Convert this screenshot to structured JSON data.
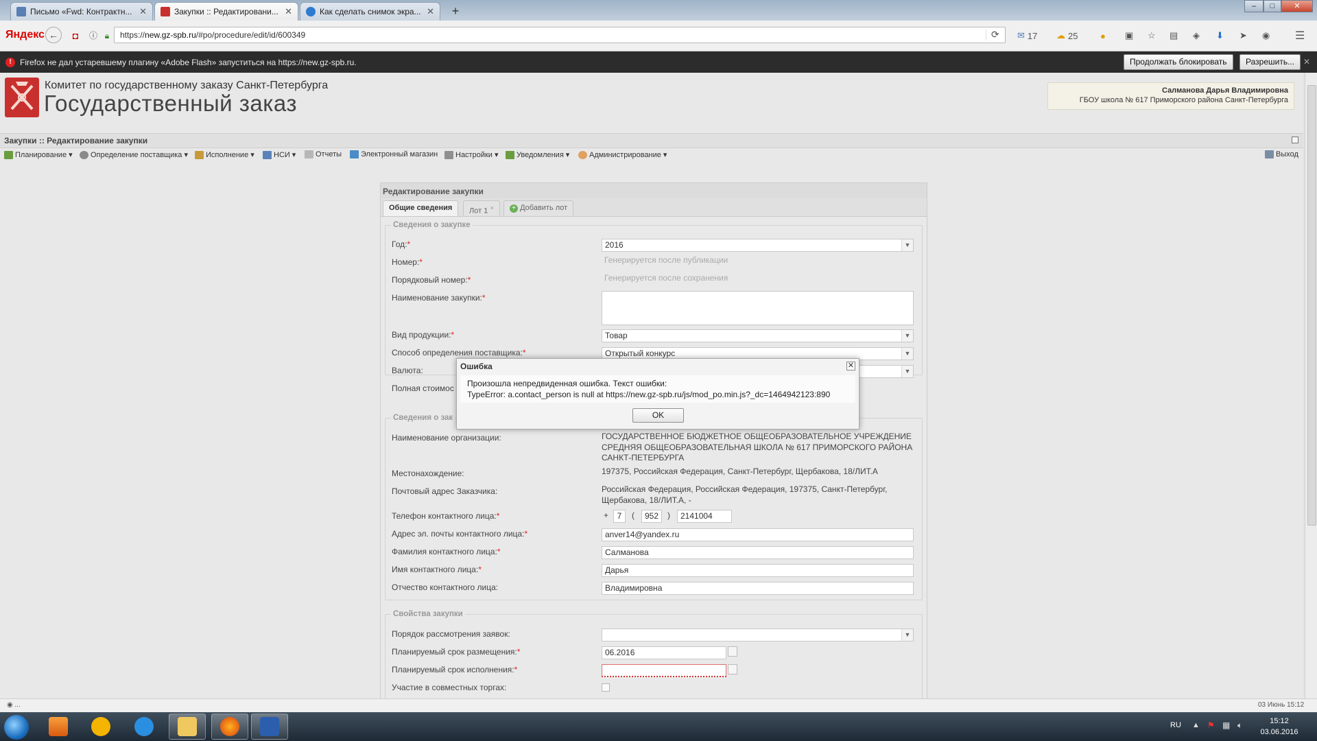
{
  "browser": {
    "tabs": [
      {
        "label": "Письмо «Fwd: Контрактн...",
        "active": false,
        "icon": "mail-icon"
      },
      {
        "label": "Закупки :: Редактировани...",
        "active": true,
        "icon": "gz-icon"
      },
      {
        "label": "Как сделать снимок экра...",
        "active": false,
        "icon": "globe-icon"
      }
    ],
    "new_tab": "+",
    "search_engine": "Яндекс",
    "url_prefix": "https://",
    "url_host": "new.gz-spb.ru",
    "url_path": "/#po/procedure/edit/id/600349",
    "toolbar": {
      "mail_count": "17",
      "weather_temp": "25"
    },
    "notification": {
      "text": "Firefox не дал устаревшему плагину «Adobe Flash» запуститься на https://new.gz-spb.ru.",
      "keep_blocking": "Продолжать блокировать",
      "allow": "Разрешить..."
    }
  },
  "site": {
    "org_line": "Комитет по государственному заказу Санкт-Петербурга",
    "title": "Государственный заказ",
    "user_name": "Салманова Дарья Владимировна",
    "user_org": "ГБОУ школа № 617 Приморского района Санкт-Петербурга",
    "breadcrumb": "Закупки :: Редактирование закупки",
    "menu": [
      {
        "label": "Планирование",
        "dropdown": true
      },
      {
        "label": "Определение поставщика",
        "dropdown": true
      },
      {
        "label": "Исполнение",
        "dropdown": true
      },
      {
        "label": "НСИ",
        "dropdown": true
      },
      {
        "label": "Отчеты",
        "dropdown": false
      },
      {
        "label": "Электронный магазин",
        "dropdown": false
      },
      {
        "label": "Настройки",
        "dropdown": true
      },
      {
        "label": "Уведомления",
        "dropdown": true
      },
      {
        "label": "Администрирование",
        "dropdown": true
      }
    ],
    "logout": "Выход"
  },
  "form": {
    "panel_title": "Редактирование закупки",
    "tabs": {
      "general": "Общие сведения",
      "lot1": "Лот 1",
      "lot1_close": "×",
      "add_lot": "Добавить лот"
    },
    "section_purchase": {
      "legend": "Сведения о закупке",
      "year_label": "Год:",
      "year_value": "2016",
      "number_label": "Номер:",
      "number_value": "Генерируется после публикации",
      "serial_label": "Порядковый номер:",
      "serial_value": "Генерируется после сохранения",
      "name_label": "Наименование закупки:",
      "name_value": "",
      "product_label": "Вид продукции:",
      "product_value": "Товар",
      "method_label": "Способ определения поставщика:",
      "method_value": "Открытый конкурс",
      "currency_label": "Валюта:",
      "total_label": "Полная стоимос"
    },
    "section_customer": {
      "legend": "Сведения о зак",
      "org_label": "Наименование организации:",
      "org_value": "ГОСУДАРСТВЕННОЕ БЮДЖЕТНОЕ ОБЩЕОБРАЗОВАТЕЛЬНОЕ УЧРЕЖДЕНИЕ СРЕДНЯЯ ОБЩЕОБРАЗОВАТЕЛЬНАЯ ШКОЛА № 617 ПРИМОРСКОГО РАЙОНА САНКТ-ПЕТЕРБУРГА",
      "location_label": "Местонахождение:",
      "location_value": "197375, Российская Федерация, Санкт-Петербург, Щербакова, 18/ЛИТ.А",
      "postal_label": "Почтовый адрес Заказчика:",
      "postal_value": "Российская Федерация, Российская Федерация, 197375, Санкт-Петербург, Щербакова, 18/ЛИТ.А, -",
      "phone_label": "Телефон контактного лица:",
      "phone_plus": "+",
      "phone_country": "7",
      "phone_open": "(",
      "phone_code": "952",
      "phone_close": ")",
      "phone_number": "2141004",
      "email_label": "Адрес эл. почты контактного лица:",
      "email_value": "anver14@yandex.ru",
      "surname_label": "Фамилия контактного лица:",
      "surname_value": "Салманова",
      "firstname_label": "Имя контактного лица:",
      "firstname_value": "Дарья",
      "patronymic_label": "Отчество контактного лица:",
      "patronymic_value": "Владимировна"
    },
    "section_props": {
      "legend": "Свойства закупки",
      "review_label": "Порядок рассмотрения заявок:",
      "review_value": "",
      "placement_label": "Планируемый срок размещения:",
      "placement_value": "06.2016",
      "execution_label": "Планируемый срок исполнения:",
      "execution_value": "",
      "joint_label": "Участие в совместных торгах:"
    }
  },
  "dialog": {
    "title": "Ошибка",
    "line1": "Произошла непредвиденная ошибка. Текст ошибки:",
    "line2": "TypeError: a.contact_person is null at https://new.gz-spb.ru/js/mod_po.min.js?_dc=1464942123:890",
    "ok": "OK"
  },
  "status": {
    "left": "...",
    "right": "03 Июнь 15:12"
  },
  "taskbar": {
    "lang": "RU",
    "time": "15:12",
    "date": "03.06.2016"
  },
  "colors": {
    "required": "#e02020",
    "notify_bg": "#2c2c2c",
    "logo_red": "#c8302e"
  }
}
